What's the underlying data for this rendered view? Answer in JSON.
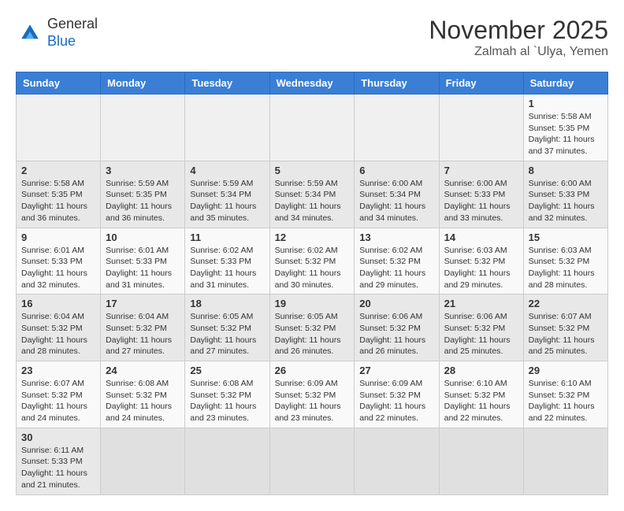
{
  "logo": {
    "general": "General",
    "blue": "Blue"
  },
  "header": {
    "month": "November 2025",
    "location": "Zalmah al `Ulya, Yemen"
  },
  "days_of_week": [
    "Sunday",
    "Monday",
    "Tuesday",
    "Wednesday",
    "Thursday",
    "Friday",
    "Saturday"
  ],
  "weeks": [
    [
      {
        "day": "",
        "info": ""
      },
      {
        "day": "",
        "info": ""
      },
      {
        "day": "",
        "info": ""
      },
      {
        "day": "",
        "info": ""
      },
      {
        "day": "",
        "info": ""
      },
      {
        "day": "",
        "info": ""
      },
      {
        "day": "1",
        "info": "Sunrise: 5:58 AM\nSunset: 5:35 PM\nDaylight: 11 hours and 37 minutes."
      }
    ],
    [
      {
        "day": "2",
        "info": "Sunrise: 5:58 AM\nSunset: 5:35 PM\nDaylight: 11 hours and 36 minutes."
      },
      {
        "day": "3",
        "info": "Sunrise: 5:59 AM\nSunset: 5:35 PM\nDaylight: 11 hours and 36 minutes."
      },
      {
        "day": "4",
        "info": "Sunrise: 5:59 AM\nSunset: 5:34 PM\nDaylight: 11 hours and 35 minutes."
      },
      {
        "day": "5",
        "info": "Sunrise: 5:59 AM\nSunset: 5:34 PM\nDaylight: 11 hours and 34 minutes."
      },
      {
        "day": "6",
        "info": "Sunrise: 6:00 AM\nSunset: 5:34 PM\nDaylight: 11 hours and 34 minutes."
      },
      {
        "day": "7",
        "info": "Sunrise: 6:00 AM\nSunset: 5:33 PM\nDaylight: 11 hours and 33 minutes."
      },
      {
        "day": "8",
        "info": "Sunrise: 6:00 AM\nSunset: 5:33 PM\nDaylight: 11 hours and 32 minutes."
      }
    ],
    [
      {
        "day": "9",
        "info": "Sunrise: 6:01 AM\nSunset: 5:33 PM\nDaylight: 11 hours and 32 minutes."
      },
      {
        "day": "10",
        "info": "Sunrise: 6:01 AM\nSunset: 5:33 PM\nDaylight: 11 hours and 31 minutes."
      },
      {
        "day": "11",
        "info": "Sunrise: 6:02 AM\nSunset: 5:33 PM\nDaylight: 11 hours and 31 minutes."
      },
      {
        "day": "12",
        "info": "Sunrise: 6:02 AM\nSunset: 5:32 PM\nDaylight: 11 hours and 30 minutes."
      },
      {
        "day": "13",
        "info": "Sunrise: 6:02 AM\nSunset: 5:32 PM\nDaylight: 11 hours and 29 minutes."
      },
      {
        "day": "14",
        "info": "Sunrise: 6:03 AM\nSunset: 5:32 PM\nDaylight: 11 hours and 29 minutes."
      },
      {
        "day": "15",
        "info": "Sunrise: 6:03 AM\nSunset: 5:32 PM\nDaylight: 11 hours and 28 minutes."
      }
    ],
    [
      {
        "day": "16",
        "info": "Sunrise: 6:04 AM\nSunset: 5:32 PM\nDaylight: 11 hours and 28 minutes."
      },
      {
        "day": "17",
        "info": "Sunrise: 6:04 AM\nSunset: 5:32 PM\nDaylight: 11 hours and 27 minutes."
      },
      {
        "day": "18",
        "info": "Sunrise: 6:05 AM\nSunset: 5:32 PM\nDaylight: 11 hours and 27 minutes."
      },
      {
        "day": "19",
        "info": "Sunrise: 6:05 AM\nSunset: 5:32 PM\nDaylight: 11 hours and 26 minutes."
      },
      {
        "day": "20",
        "info": "Sunrise: 6:06 AM\nSunset: 5:32 PM\nDaylight: 11 hours and 26 minutes."
      },
      {
        "day": "21",
        "info": "Sunrise: 6:06 AM\nSunset: 5:32 PM\nDaylight: 11 hours and 25 minutes."
      },
      {
        "day": "22",
        "info": "Sunrise: 6:07 AM\nSunset: 5:32 PM\nDaylight: 11 hours and 25 minutes."
      }
    ],
    [
      {
        "day": "23",
        "info": "Sunrise: 6:07 AM\nSunset: 5:32 PM\nDaylight: 11 hours and 24 minutes."
      },
      {
        "day": "24",
        "info": "Sunrise: 6:08 AM\nSunset: 5:32 PM\nDaylight: 11 hours and 24 minutes."
      },
      {
        "day": "25",
        "info": "Sunrise: 6:08 AM\nSunset: 5:32 PM\nDaylight: 11 hours and 23 minutes."
      },
      {
        "day": "26",
        "info": "Sunrise: 6:09 AM\nSunset: 5:32 PM\nDaylight: 11 hours and 23 minutes."
      },
      {
        "day": "27",
        "info": "Sunrise: 6:09 AM\nSunset: 5:32 PM\nDaylight: 11 hours and 22 minutes."
      },
      {
        "day": "28",
        "info": "Sunrise: 6:10 AM\nSunset: 5:32 PM\nDaylight: 11 hours and 22 minutes."
      },
      {
        "day": "29",
        "info": "Sunrise: 6:10 AM\nSunset: 5:32 PM\nDaylight: 11 hours and 22 minutes."
      }
    ],
    [
      {
        "day": "30",
        "info": "Sunrise: 6:11 AM\nSunset: 5:33 PM\nDaylight: 11 hours and 21 minutes."
      },
      {
        "day": "",
        "info": ""
      },
      {
        "day": "",
        "info": ""
      },
      {
        "day": "",
        "info": ""
      },
      {
        "day": "",
        "info": ""
      },
      {
        "day": "",
        "info": ""
      },
      {
        "day": "",
        "info": ""
      }
    ]
  ]
}
